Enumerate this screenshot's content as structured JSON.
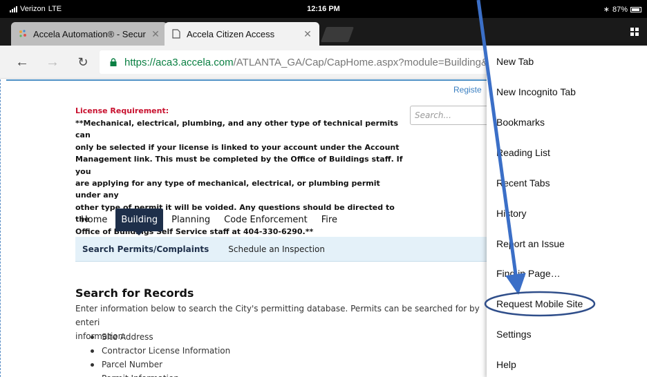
{
  "status_bar": {
    "carrier": "Verizon",
    "network": "LTE",
    "time": "12:16 PM",
    "battery": "87%"
  },
  "tabs": [
    {
      "title": "Accela Automation® - Secur"
    },
    {
      "title": "Accela Citizen Access"
    }
  ],
  "toolbar": {
    "url_host": "https://aca3.accela.com",
    "url_path": "/ATLANTA_GA/Cap/CapHome.aspx?module=Building&T"
  },
  "page": {
    "register_link": "Registe",
    "search_placeholder": "Search...",
    "license_title": "License Requirement:",
    "license_lines": [
      "**Mechanical, electrical, plumbing, and any other type of technical permits can",
      "only be selected if your license is linked to your account under the Account",
      "Management link. This must be completed by the Office of Buildings staff. If you",
      "are applying for any type of mechanical, electrical, or plumbing permit under any",
      "other type of permit it will be voided.  Any questions should be directed to the",
      "Office of Buildings Self Service staff at 404-330-6290.**"
    ],
    "main_nav": [
      "Home",
      "Building",
      "Planning",
      "Code Enforcement",
      "Fire"
    ],
    "sub_nav": [
      "Search Permits/Complaints",
      "Schedule an Inspection"
    ],
    "records_heading": "Search for Records",
    "records_intro_lines": [
      "Enter information below to search the City's permitting database. Permits can be searched for by enteri",
      "information:"
    ],
    "records_list": [
      "Site Address",
      "Contractor License Information",
      "Parcel Number",
      "Permit Information"
    ]
  },
  "menu": {
    "items": [
      "New Tab",
      "New Incognito Tab",
      "Bookmarks",
      "Reading List",
      "Recent Tabs",
      "History",
      "Report an Issue",
      "Find in Page…",
      "Request Mobile Site",
      "Settings",
      "Help"
    ]
  },
  "colors": {
    "annotation_blue": "#3b6fc7",
    "nav_active": "#1e2f4a",
    "license_red": "#c8102e",
    "url_green": "#0b8043"
  }
}
